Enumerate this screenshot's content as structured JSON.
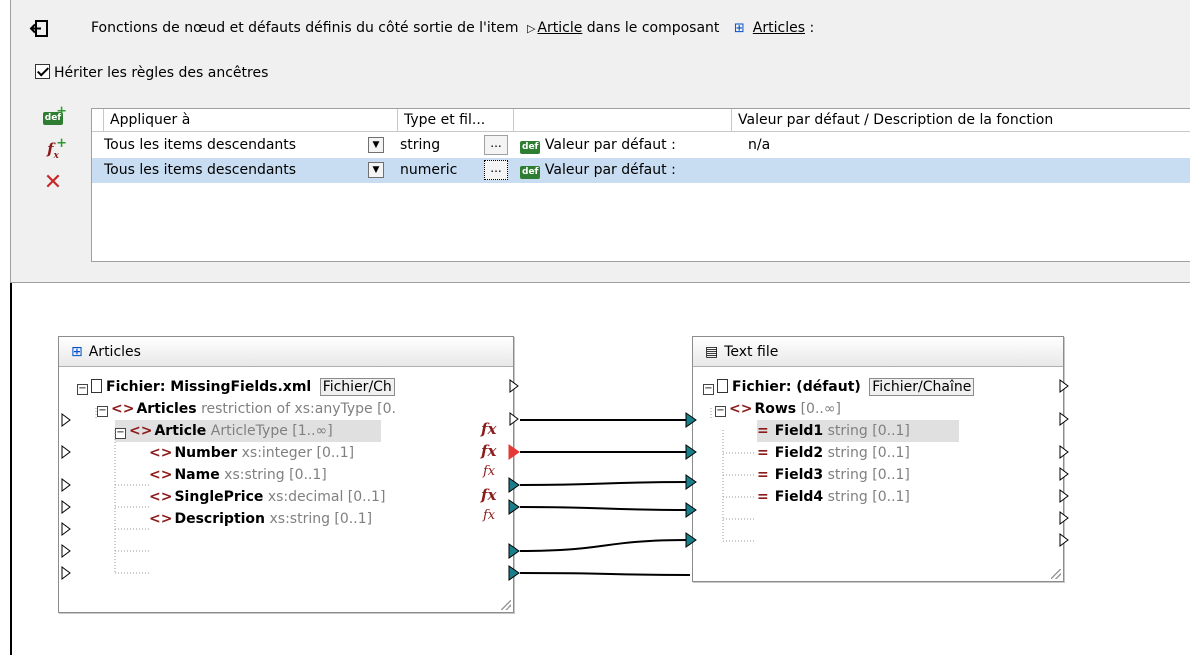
{
  "header": {
    "text_before": "Fonctions de nœud et défauts définis du côté sortie de l'item",
    "item_link": "Article",
    "text_middle": "dans le composant",
    "component_link": "Articles",
    "text_after": ":"
  },
  "inherit_checkbox": {
    "label": "Hériter les règles des ancêtres",
    "checked": true
  },
  "toolbar": {
    "add_default_icon": "add-default-icon",
    "add_function_icon": "add-function-icon",
    "delete_icon": "delete-icon"
  },
  "grid": {
    "columns": [
      "Appliquer à",
      "Type et fil...",
      "",
      "Valeur par défaut / Description de la fonction"
    ],
    "rows": [
      {
        "apply_to": "Tous les items descendants",
        "type": "string",
        "ellipsis": "...",
        "kind": "Valeur par défaut :",
        "value": "n/a"
      },
      {
        "apply_to": "Tous les items descendants",
        "type": "numeric",
        "ellipsis": "...",
        "kind": "Valeur par défaut :",
        "value": ""
      }
    ]
  },
  "source_component": {
    "title": "Articles",
    "file_label": "Fichier: MissingFields.xml",
    "file_button": "Fichier/Ch",
    "nodes": [
      {
        "name": "Articles",
        "type": "restriction of xs:anyType [0."
      },
      {
        "name": "Article",
        "type": "ArticleType [1..∞]"
      },
      {
        "name": "Number",
        "type": "xs:integer [0..1]"
      },
      {
        "name": "Name",
        "type": "xs:string [0..1]"
      },
      {
        "name": "SinglePrice",
        "type": "xs:decimal [0..1]"
      },
      {
        "name": "Description",
        "type": "xs:string [0..1]"
      }
    ]
  },
  "target_component": {
    "title": "Text file",
    "file_label": "Fichier: (défaut)",
    "file_button": "Fichier/Chaîne",
    "nodes": [
      {
        "name": "Rows",
        "type": "[0..∞]"
      },
      {
        "name": "Field1",
        "type": "string [0..1]"
      },
      {
        "name": "Field2",
        "type": "string [0..1]"
      },
      {
        "name": "Field3",
        "type": "string [0..1]"
      },
      {
        "name": "Field4",
        "type": "string [0..1]"
      }
    ]
  },
  "fx_marker": "fx",
  "colors": {
    "selected_row": "#c9ddf2",
    "element_icon": "#8b1a1a",
    "connector": "#000000",
    "connector_out": "#1a7f8a",
    "active_connector": "#e53935"
  }
}
